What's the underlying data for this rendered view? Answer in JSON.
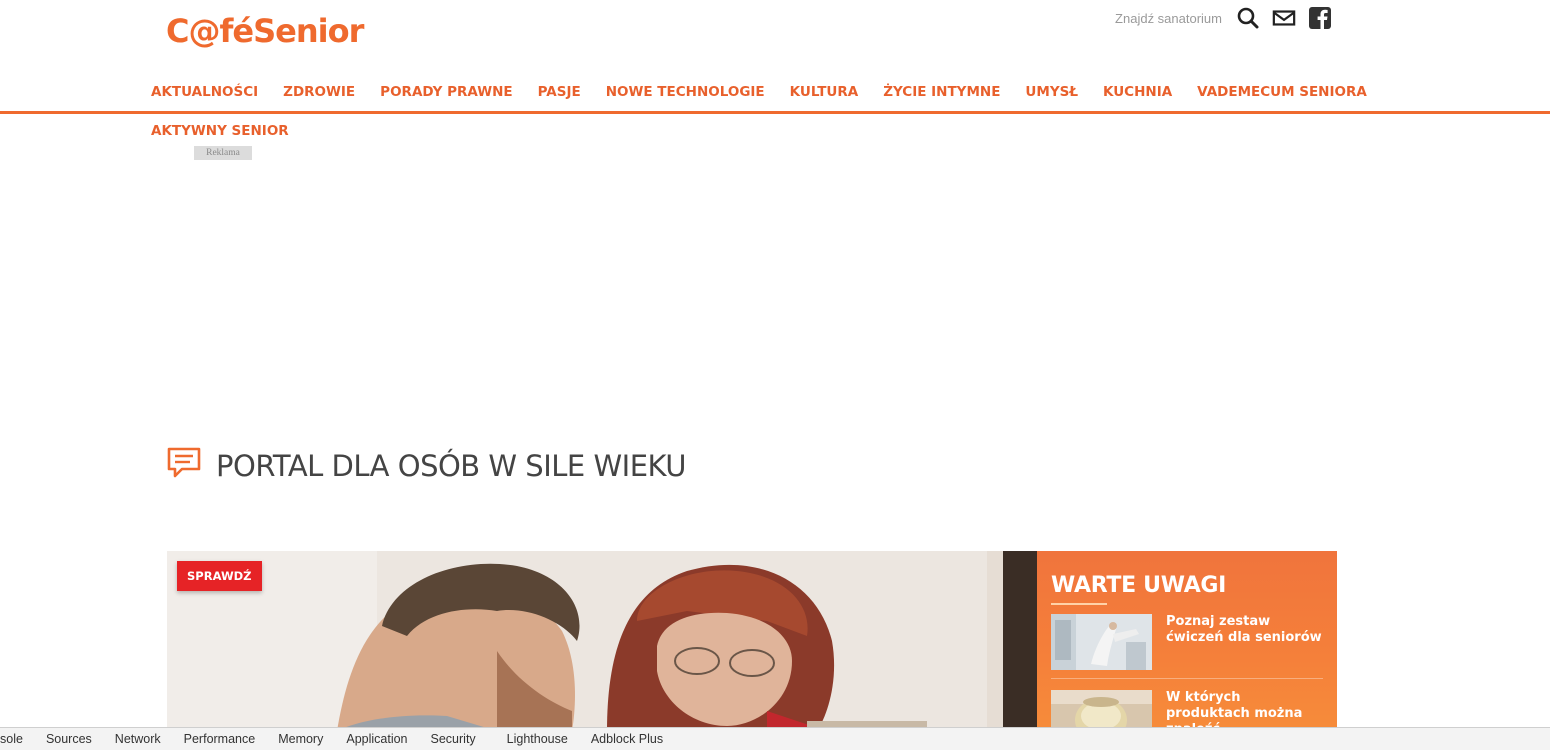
{
  "brand": {
    "logo_text": "C@féSenior",
    "accent_color": "#ef6a2e"
  },
  "top_bar": {
    "find_sanatorium": "Znajdź sanatorium",
    "icons": [
      "search-icon",
      "mail-icon",
      "facebook-icon"
    ]
  },
  "nav": {
    "items": [
      "AKTUALNOŚCI",
      "ZDROWIE",
      "PORADY PRAWNE",
      "PASJE",
      "NOWE TECHNOLOGIE",
      "KULTURA",
      "ŻYCIE INTYMNE",
      "UMYSŁ",
      "KUCHNIA",
      "VADEMECUM SENIORA"
    ],
    "second_row": "AKTYWNY SENIOR"
  },
  "ad": {
    "label": "Reklama"
  },
  "section": {
    "title": "PORTAL DLA OSÓB W SILE WIEKU",
    "icon": "comment-icon"
  },
  "hero": {
    "badge": "SPRAWDŹ",
    "badge_color": "#e62326"
  },
  "sidebar": {
    "title": "WARTE UWAGI",
    "items": [
      {
        "title": "Poznaj zestaw ćwiczeń dla seniorów"
      },
      {
        "title": "W których produktach można znaleźć"
      }
    ]
  },
  "devtools": {
    "tabs": [
      "sole",
      "Sources",
      "Network",
      "Performance",
      "Memory",
      "Application",
      "Security",
      "Lighthouse",
      "Adblock Plus"
    ]
  }
}
